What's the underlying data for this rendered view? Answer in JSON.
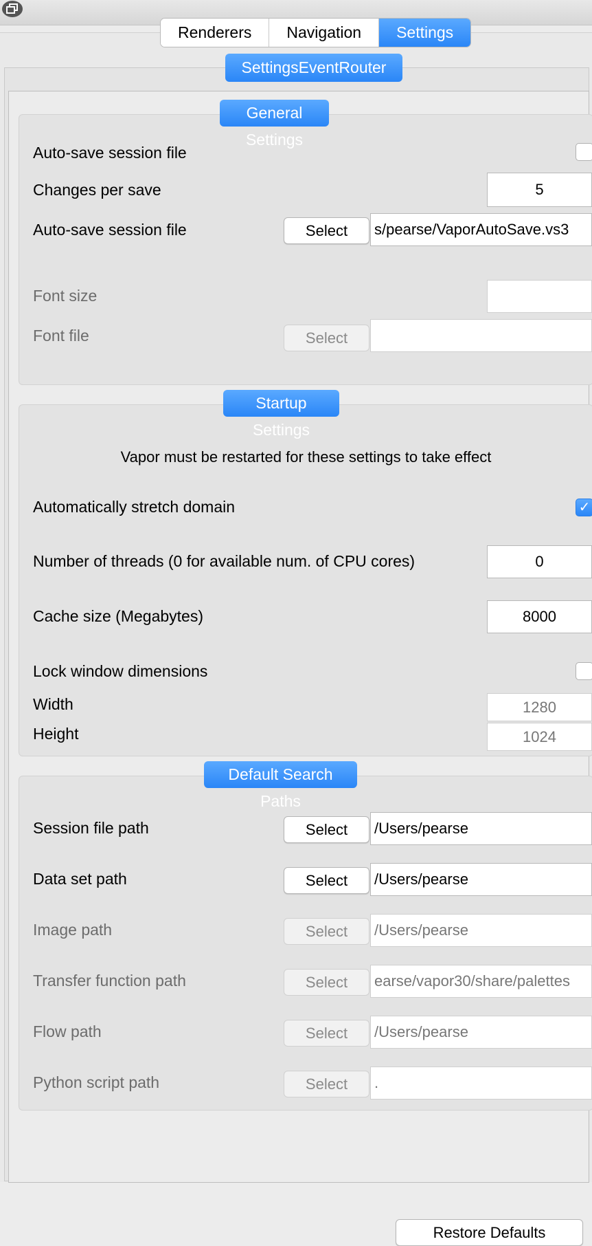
{
  "tabs": [
    "Renderers",
    "Navigation",
    "Settings"
  ],
  "router_title": "SettingsEventRouter",
  "general": {
    "title": "General Settings",
    "autosave_label": "Auto-save session file",
    "changes_label": "Changes per save",
    "changes_value": "5",
    "autosave_file_label": "Auto-save session file",
    "select": "Select",
    "autosave_file_value": "s/pearse/VaporAutoSave.vs3",
    "font_size_label": "Font size",
    "font_size_value": "",
    "font_file_label": "Font file",
    "font_file_value": ""
  },
  "startup": {
    "title": "Startup Settings",
    "note": "Vapor must be restarted for these settings to take effect",
    "stretch_label": "Automatically stretch domain",
    "threads_label": "Number of threads (0 for available num. of CPU cores)",
    "threads_value": "0",
    "cache_label": "Cache size (Megabytes)",
    "cache_value": "8000",
    "lock_label": "Lock window dimensions",
    "width_label": "Width",
    "width_value": "1280",
    "height_label": "Height",
    "height_value": "1024"
  },
  "paths": {
    "title": "Default Search Paths",
    "session_label": "Session file path",
    "session_value": "/Users/pearse",
    "data_label": "Data set path",
    "data_value": "/Users/pearse",
    "image_label": "Image path",
    "image_value": "/Users/pearse",
    "tf_label": "Transfer function path",
    "tf_value": "earse/vapor30/share/palettes",
    "flow_label": "Flow path",
    "flow_value": "/Users/pearse",
    "python_label": "Python script path",
    "python_value": "."
  },
  "restore_label": "Restore Defaults",
  "check_mark": "✓"
}
